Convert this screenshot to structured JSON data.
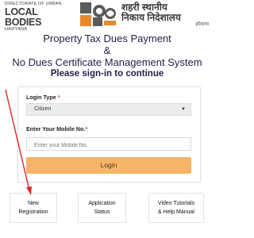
{
  "header": {
    "dept_line1": "DIRECTORATE OF URBAN",
    "dept_line2": "LOCAL BODIES",
    "dept_line3": "HARYANA",
    "hindi_line1": "शहरी स्थानीय",
    "hindi_line2": "निकाय निदेशालय",
    "hindi_line3": "हरियाणा",
    "logo_icon": "ulb-logo-icon"
  },
  "titles": {
    "line1": "Property Tax Dues Payment",
    "line2": "&",
    "line3": "No Dues Certificate Management System",
    "line4": "Please sign-in to continue"
  },
  "form": {
    "login_type_label": "Login Type",
    "login_type_required": "*",
    "login_type_value": "Citizen",
    "mobile_label": "Enter Your Mobile No.",
    "mobile_required": "*",
    "mobile_placeholder": "Enter your Mobile No.",
    "login_button": "Login"
  },
  "tiles": {
    "new_registration_l1": "New",
    "new_registration_l2": "Registration",
    "application_status_l1": "Application",
    "application_status_l2": "Status",
    "video_tutorials_l1": "Video Tutorials",
    "video_tutorials_l2": "& Help Manual"
  },
  "colors": {
    "accent_button": "#f6b466",
    "annotation_arrow": "#e0262a",
    "title_text": "#1f1f4a"
  }
}
